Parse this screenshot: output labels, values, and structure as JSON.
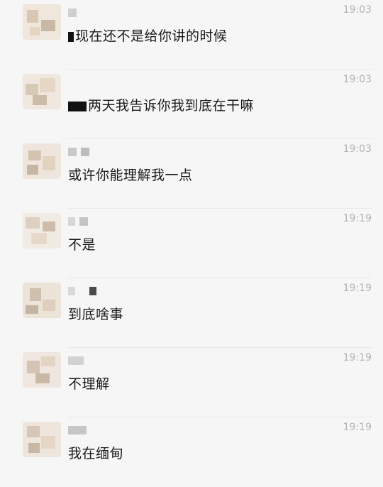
{
  "messages": [
    {
      "text": "现在还不是给你讲的时候",
      "time": "19:03"
    },
    {
      "text": "两天我告诉你我到底在干嘛",
      "time": "19:03"
    },
    {
      "text": "或许你能理解我一点",
      "time": "19:03"
    },
    {
      "text": "不是",
      "time": "19:19"
    },
    {
      "text": "到底啥事",
      "time": "19:19"
    },
    {
      "text": "不理解",
      "time": "19:19"
    },
    {
      "text": "我在缅甸",
      "time": "19:19"
    }
  ]
}
